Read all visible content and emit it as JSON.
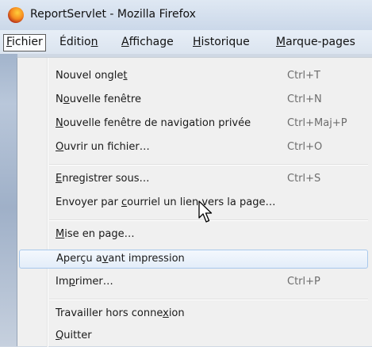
{
  "window": {
    "title": "ReportServlet - Mozilla Firefox"
  },
  "menubar": [
    {
      "pre": "",
      "key": "F",
      "post": "ichier",
      "open": true
    },
    {
      "pre": "Éditio",
      "key": "n",
      "post": ""
    },
    {
      "pre": "",
      "key": "A",
      "post": "ffichage"
    },
    {
      "pre": "",
      "key": "H",
      "post": "istorique"
    },
    {
      "pre": "",
      "key": "M",
      "post": "arque-pages"
    }
  ],
  "menu": {
    "items": [
      {
        "pre": "Nouvel ongle",
        "key": "t",
        "post": "",
        "shortcut": "Ctrl+T"
      },
      {
        "pre": "N",
        "key": "o",
        "post": "uvelle fenêtre",
        "shortcut": "Ctrl+N"
      },
      {
        "pre": "",
        "key": "N",
        "post": "ouvelle fenêtre de navigation privée",
        "shortcut": "Ctrl+Maj+P"
      },
      {
        "pre": "",
        "key": "O",
        "post": "uvrir un fichier…",
        "shortcut": "Ctrl+O"
      },
      {
        "pre": "",
        "key": "E",
        "post": "nregistrer sous…",
        "shortcut": "Ctrl+S"
      },
      {
        "pre": "Envoyer par ",
        "key": "c",
        "post": "ourriel un lien vers la page…",
        "shortcut": ""
      },
      {
        "pre": "",
        "key": "M",
        "post": "ise en page…",
        "shortcut": ""
      },
      {
        "pre": "Aperçu a",
        "key": "v",
        "post": "ant impression",
        "shortcut": "",
        "highlighted": true
      },
      {
        "pre": "Im",
        "key": "p",
        "post": "rimer…",
        "shortcut": "Ctrl+P"
      },
      {
        "pre": "Travailler hors conne",
        "key": "x",
        "post": "ion",
        "shortcut": ""
      },
      {
        "pre": "",
        "key": "Q",
        "post": "uitter",
        "shortcut": ""
      }
    ]
  }
}
